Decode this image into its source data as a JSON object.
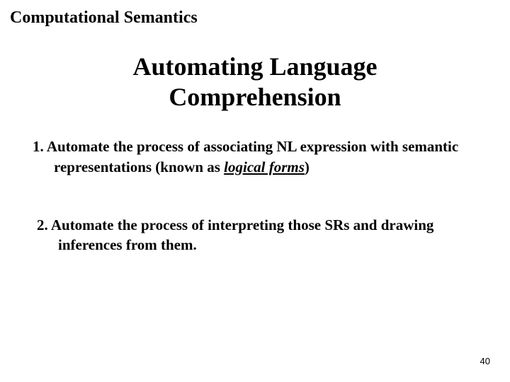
{
  "header": "Computational Semantics",
  "title_line1": "Automating Language",
  "title_line2": "Comprehension",
  "items": [
    {
      "num": "1.",
      "pre": "Automate the process of associating NL expression with semantic representations (known as ",
      "emph": "logical forms",
      "post": ")"
    },
    {
      "num": "2.",
      "pre": "Automate the process of interpreting those SRs and drawing inferences from them.",
      "emph": "",
      "post": ""
    }
  ],
  "page_number": "40"
}
